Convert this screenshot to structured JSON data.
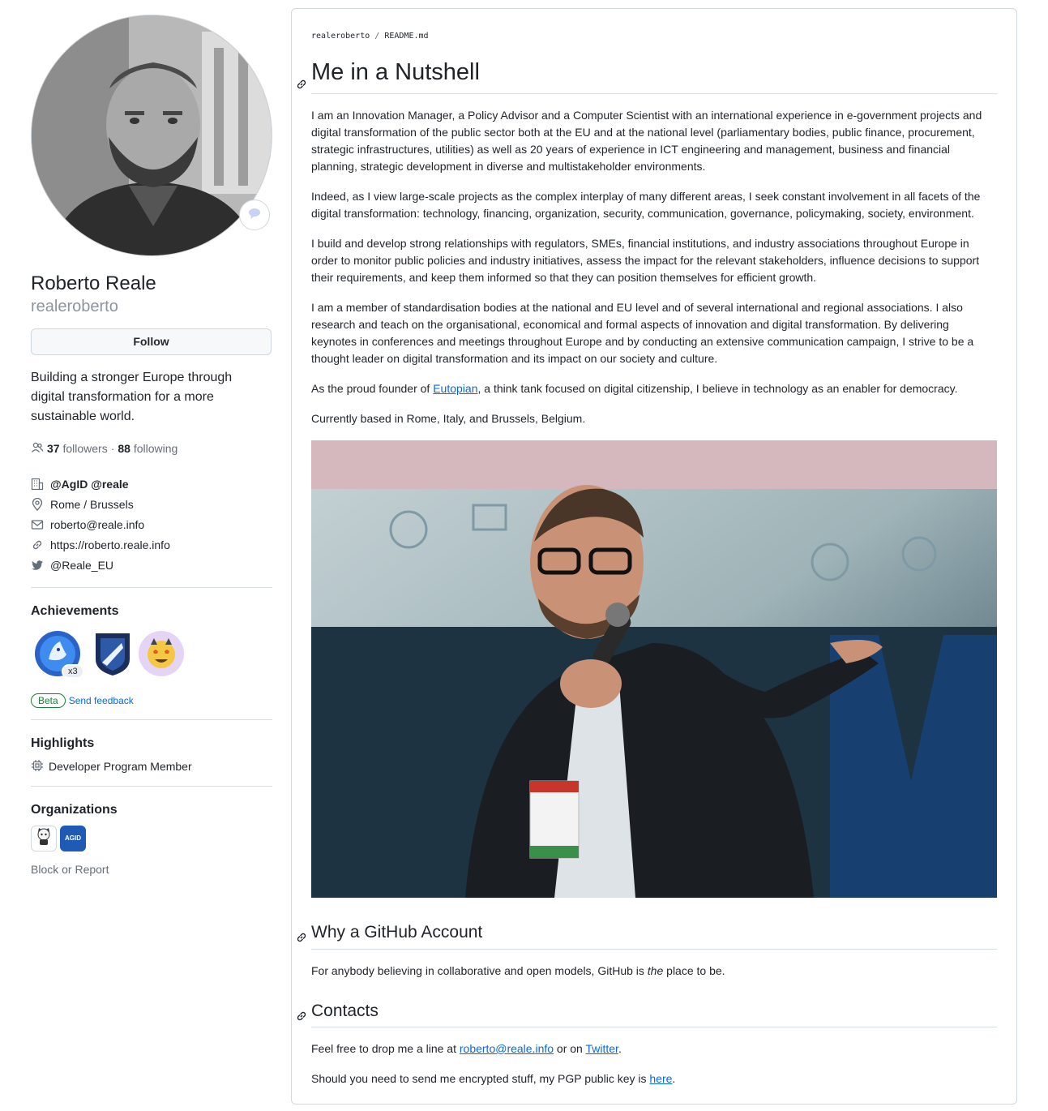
{
  "profile": {
    "name": "Roberto Reale",
    "login": "realeroberto",
    "follow_label": "Follow",
    "bio": "Building a stronger Europe through digital transformation for a more sustainable world.",
    "followers_count": "37",
    "followers_label": "followers",
    "separator": "·",
    "following_count": "88",
    "following_label": "following",
    "organization": "@AgID @reale",
    "location": "Rome / Brussels",
    "email": "roberto@reale.info",
    "website": "https://roberto.reale.info",
    "twitter": "@Reale_EU"
  },
  "achievements": {
    "title": "Achievements",
    "count_badge": "x3",
    "beta_label": "Beta",
    "feedback_label": "Send feedback"
  },
  "highlights": {
    "title": "Highlights",
    "item": "Developer Program Member"
  },
  "organizations": {
    "title": "Organizations",
    "agid_label": "AGID"
  },
  "block_report": "Block or Report",
  "readme": {
    "owner": "realeroberto",
    "slash": "/",
    "file": "README.md",
    "heading1": "Me in a Nutshell",
    "p1": "I am an Innovation Manager, a Policy Advisor and a Computer Scientist with an international experience in e-government projects and digital transformation of the public sector both at the EU and at the national level (parliamentary bodies, public finance, procurement, strategic infrastructures, utilities) as well as 20 years of experience in ICT engineering and management, business and financial planning, strategic development in diverse and multistakeholder environments.",
    "p2": "Indeed, as I view large-scale projects as the complex interplay of many different areas, I seek constant involvement in all facets of the digital transformation: technology, financing, organization, security, communication, governance, policymaking, society, environment.",
    "p3": "I build and develop strong relationships with regulators, SMEs, financial institutions, and industry associations throughout Europe in order to monitor public policies and industry initiatives, assess the impact for the relevant stakeholders, influence decisions to support their requirements, and keep them informed so that they can position themselves for efficient growth.",
    "p4": "I am a member of standardisation bodies at the national and EU level and of several international and regional associations. I also research and teach on the organisational, economical and formal aspects of innovation and digital transformation. By delivering keynotes in conferences and meetings throughout Europe and by conducting an extensive communication campaign, I strive to be a thought leader on digital transformation and its impact on our society and culture.",
    "p5_before": "As the proud founder of ",
    "p5_link": "Eutopian",
    "p5_after": ", a think tank focused on digital citizenship, I believe in technology as an enabler for democracy.",
    "p6": "Currently based in Rome, Italy, and Brussels, Belgium.",
    "heading2": "Why a GitHub Account",
    "p7_before": "For anybody believing in collaborative and open models, GitHub is ",
    "p7_em": "the",
    "p7_after": " place to be.",
    "heading3": "Contacts",
    "p8_before": "Feel free to drop me a line at ",
    "p8_email": "roberto@reale.info",
    "p8_mid": " or on ",
    "p8_twitter": "Twitter",
    "p8_after": ".",
    "p9_before": "Should you need to send me encrypted stuff, my PGP public key is ",
    "p9_link": "here",
    "p9_after": "."
  }
}
